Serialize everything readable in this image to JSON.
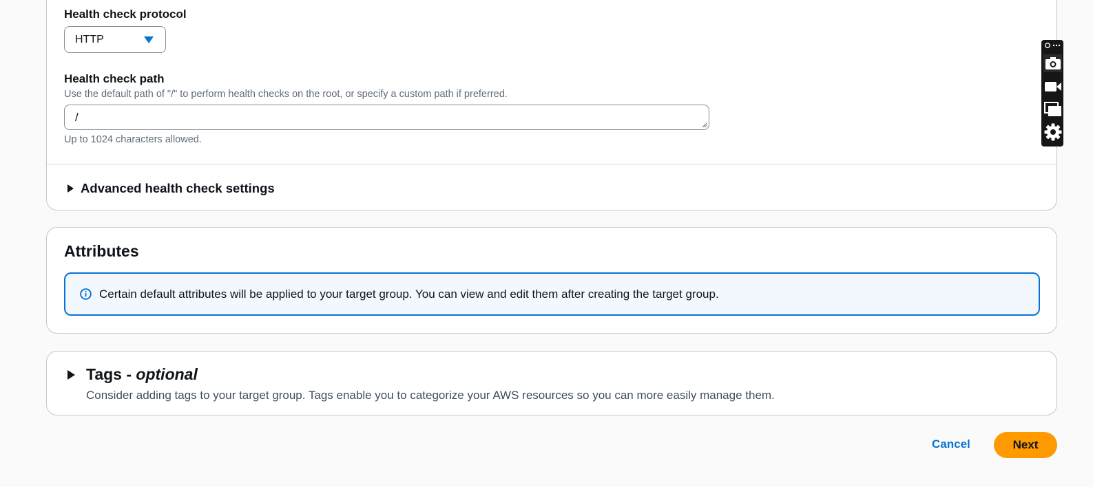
{
  "health_check": {
    "protocol_label": "Health check protocol",
    "protocol_value": "HTTP",
    "path_label": "Health check path",
    "path_description": "Use the default path of \"/\" to perform health checks on the root, or specify a custom path if preferred.",
    "path_value": "/",
    "path_constraint": "Up to 1024 characters allowed.",
    "advanced_label": "Advanced health check settings"
  },
  "attributes": {
    "title": "Attributes",
    "info_message": "Certain default attributes will be applied to your target group. You can view and edit them after creating the target group."
  },
  "tags": {
    "title": "Tags - ",
    "title_optional": "optional",
    "description": "Consider adding tags to your target group. Tags enable you to categorize your AWS resources so you can more easily manage them."
  },
  "footer": {
    "cancel_label": "Cancel",
    "next_label": "Next"
  },
  "extension_toolbar": {
    "buttons": [
      "camera-icon",
      "video-icon",
      "windows-icon",
      "gear-icon"
    ]
  },
  "colors": {
    "accent": "#0972d3",
    "primary_button": "#ff9900",
    "info_background": "#f2f8fd"
  }
}
